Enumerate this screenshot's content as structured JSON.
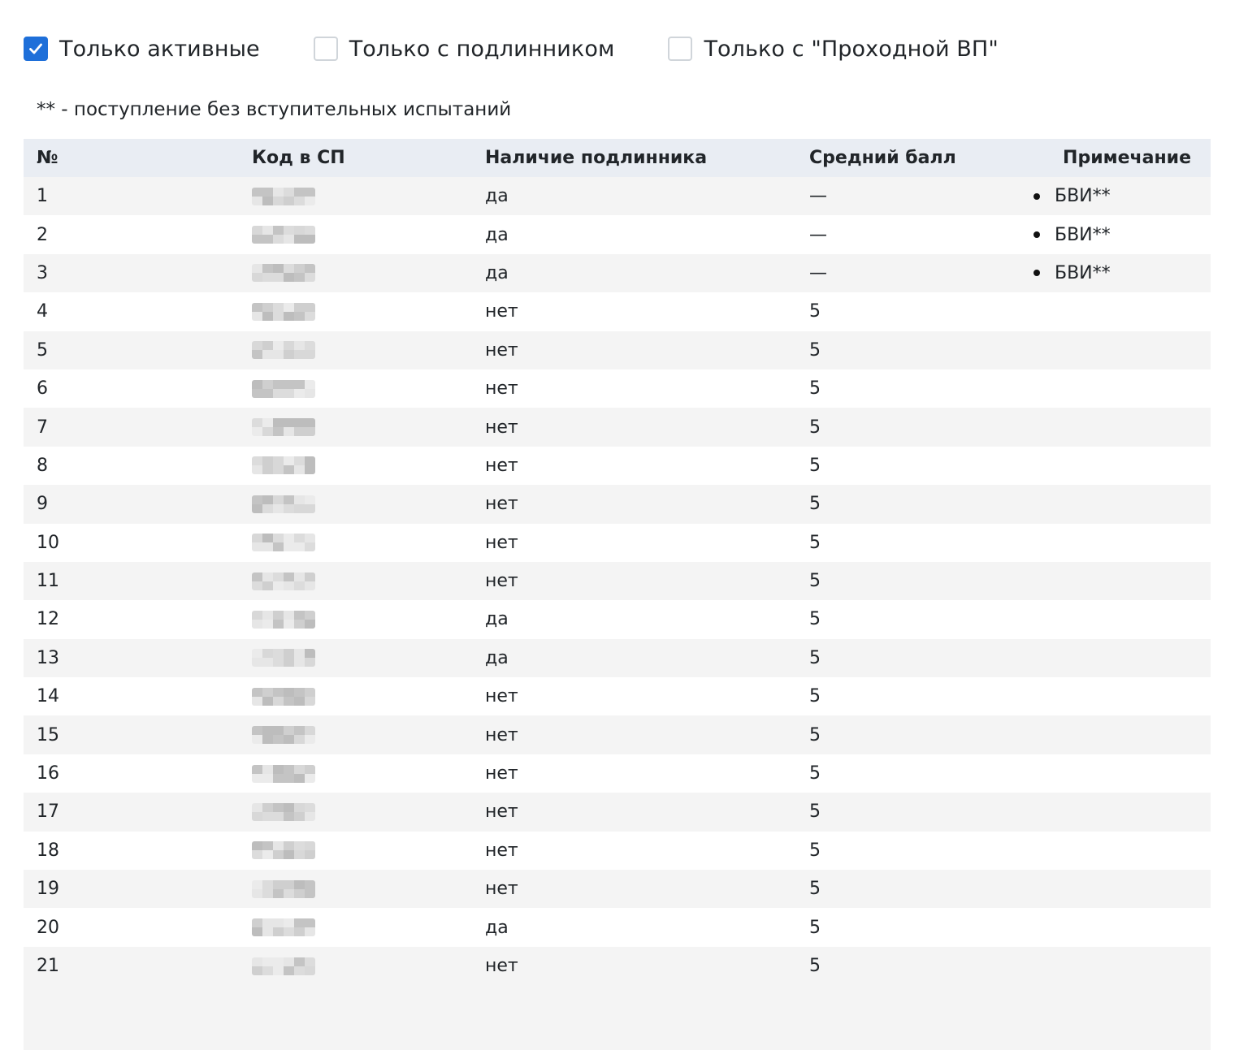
{
  "filters": [
    {
      "label": "Только активные",
      "checked": true
    },
    {
      "label": "Только с подлинником",
      "checked": false
    },
    {
      "label": "Только с \"Проходной ВП\"",
      "checked": false
    }
  ],
  "legend_note": "** - поступление без вступительных испытаний",
  "table": {
    "headers": [
      "№",
      "Код в СП",
      "Наличие подлинника",
      "Средний балл",
      "Примечание"
    ],
    "rows": [
      {
        "num": "1",
        "original": "да",
        "avg": "—",
        "note": "БВИ**"
      },
      {
        "num": "2",
        "original": "да",
        "avg": "—",
        "note": "БВИ**"
      },
      {
        "num": "3",
        "original": "да",
        "avg": "—",
        "note": "БВИ**"
      },
      {
        "num": "4",
        "original": "нет",
        "avg": "5",
        "note": ""
      },
      {
        "num": "5",
        "original": "нет",
        "avg": "5",
        "note": ""
      },
      {
        "num": "6",
        "original": "нет",
        "avg": "5",
        "note": ""
      },
      {
        "num": "7",
        "original": "нет",
        "avg": "5",
        "note": ""
      },
      {
        "num": "8",
        "original": "нет",
        "avg": "5",
        "note": ""
      },
      {
        "num": "9",
        "original": "нет",
        "avg": "5",
        "note": ""
      },
      {
        "num": "10",
        "original": "нет",
        "avg": "5",
        "note": ""
      },
      {
        "num": "11",
        "original": "нет",
        "avg": "5",
        "note": ""
      },
      {
        "num": "12",
        "original": "да",
        "avg": "5",
        "note": ""
      },
      {
        "num": "13",
        "original": "да",
        "avg": "5",
        "note": ""
      },
      {
        "num": "14",
        "original": "нет",
        "avg": "5",
        "note": ""
      },
      {
        "num": "15",
        "original": "нет",
        "avg": "5",
        "note": ""
      },
      {
        "num": "16",
        "original": "нет",
        "avg": "5",
        "note": ""
      },
      {
        "num": "17",
        "original": "нет",
        "avg": "5",
        "note": ""
      },
      {
        "num": "18",
        "original": "нет",
        "avg": "5",
        "note": ""
      },
      {
        "num": "19",
        "original": "нет",
        "avg": "5",
        "note": ""
      },
      {
        "num": "20",
        "original": "да",
        "avg": "5",
        "note": ""
      },
      {
        "num": "21",
        "original": "нет",
        "avg": "5",
        "note": ""
      }
    ]
  },
  "colors": {
    "accent": "#1e6fd9",
    "header_bg": "#e9edf3",
    "stripe_bg": "#f4f4f4"
  },
  "icons": {
    "checkbox_checked": "check-icon",
    "list_bullet": "bullet-icon",
    "redacted_code": "pixelated-code"
  }
}
